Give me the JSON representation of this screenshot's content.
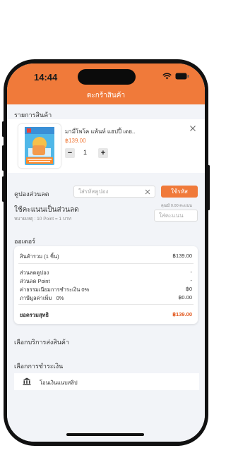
{
  "status": {
    "time": "14:44"
  },
  "header": {
    "title": "ตะกร้าสินค้า"
  },
  "products": {
    "section_title": "รายการสินค้า",
    "item": {
      "name": "มามี่โพโค แพ้นท์ แฮปปี้ เดย..",
      "price": "฿139.00",
      "quantity": "1",
      "remove_icon": "close-icon"
    }
  },
  "coupon": {
    "label": "คูปองส่วนลด",
    "placeholder": "ใส่รหัสคูปอง",
    "apply_label": "ใช้รหัส"
  },
  "points": {
    "label": "ใช้คะแนนเป็นส่วนลด",
    "note": "หมายเหตุ : 10 Point = 1 บาท",
    "available": "คุณมี 0.00 คะแนน",
    "placeholder": "ใส่คะแนน"
  },
  "order": {
    "section_title": "ออเดอร์",
    "subtotal_label": "สินค้ารวม (1 ชิ้น)",
    "subtotal_value": "฿139.00",
    "coupon_discount_label": "ส่วนลดคูปอง",
    "coupon_discount_value": "-",
    "point_discount_label": "ส่วนลด Point",
    "point_discount_value": "-",
    "fee_label": "ค่าธรรมเนียมการชำระเงิน 0%",
    "fee_value": "฿0",
    "vat_label": "ภาษีมูลค่าเพิ่ม   0%",
    "vat_value": "฿0.00",
    "total_label": "ยอดรวมสุทธิ",
    "total_value": "฿139.00"
  },
  "shipping": {
    "section_title": "เลือกบริการส่งสินค้า"
  },
  "payment": {
    "section_title": "เลือกการชำระเงิน",
    "method_label": "โอนเงินแนบสลิป"
  },
  "colors": {
    "accent": "#f07a3a",
    "total": "#e2561b"
  }
}
